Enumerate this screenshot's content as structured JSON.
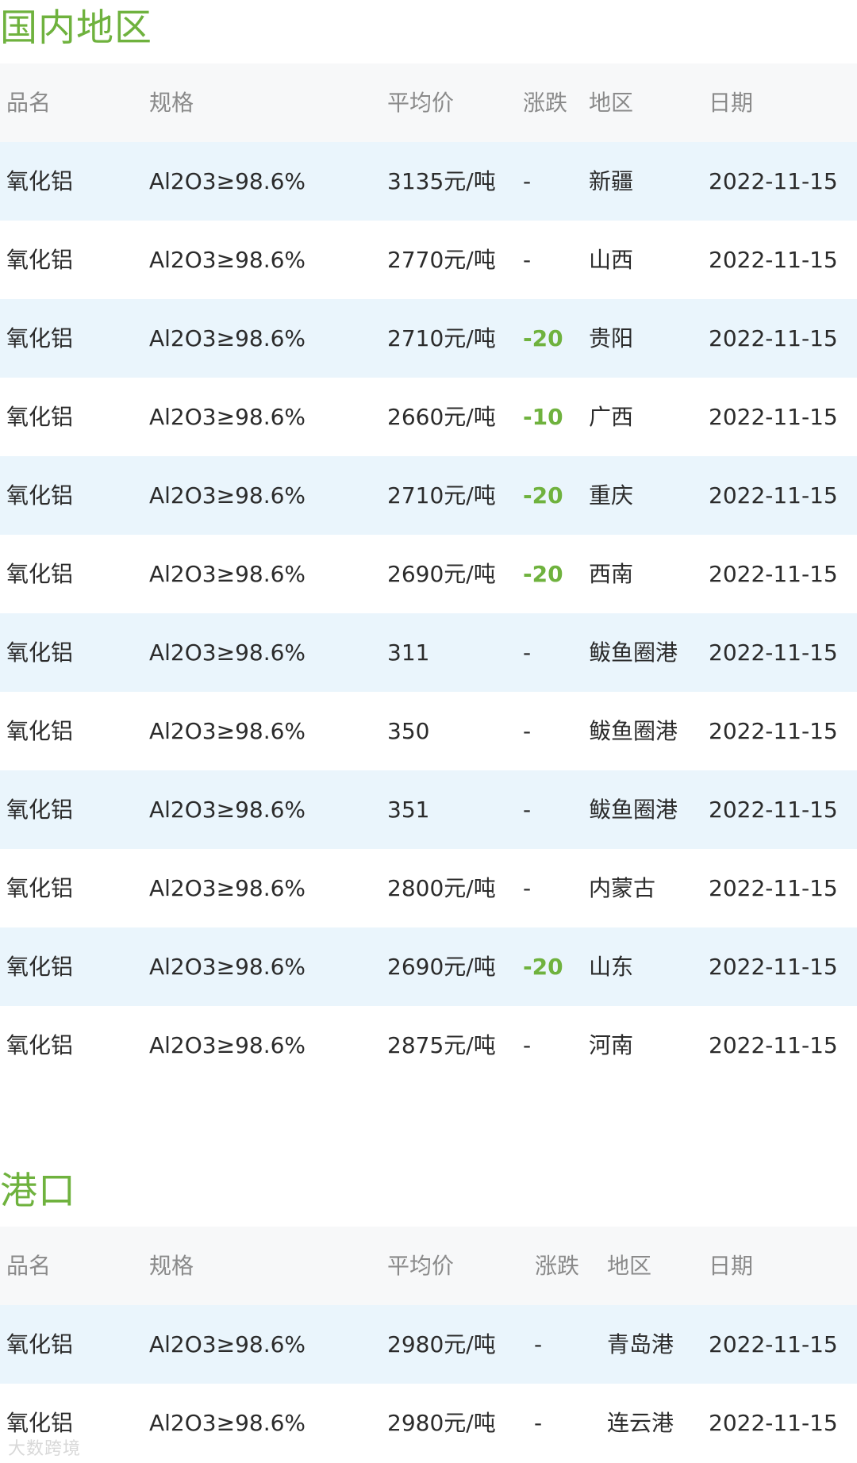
{
  "domestic": {
    "title": "国内地区",
    "headers": {
      "name": "品名",
      "spec": "规格",
      "price": "平均价",
      "change": "涨跌",
      "region": "地区",
      "date": "日期"
    },
    "rows": [
      {
        "name": "氧化铝",
        "spec": "Al2O3≥98.6%",
        "price": "3135元/吨",
        "change": "-",
        "region": "新疆",
        "date": "2022-11-15"
      },
      {
        "name": "氧化铝",
        "spec": "Al2O3≥98.6%",
        "price": "2770元/吨",
        "change": "-",
        "region": "山西",
        "date": "2022-11-15"
      },
      {
        "name": "氧化铝",
        "spec": "Al2O3≥98.6%",
        "price": "2710元/吨",
        "change": "-20",
        "region": "贵阳",
        "date": "2022-11-15"
      },
      {
        "name": "氧化铝",
        "spec": "Al2O3≥98.6%",
        "price": "2660元/吨",
        "change": "-10",
        "region": "广西",
        "date": "2022-11-15"
      },
      {
        "name": "氧化铝",
        "spec": "Al2O3≥98.6%",
        "price": "2710元/吨",
        "change": "-20",
        "region": "重庆",
        "date": "2022-11-15"
      },
      {
        "name": "氧化铝",
        "spec": "Al2O3≥98.6%",
        "price": "2690元/吨",
        "change": "-20",
        "region": "西南",
        "date": "2022-11-15"
      },
      {
        "name": "氧化铝",
        "spec": "Al2O3≥98.6%",
        "price": "311",
        "change": "-",
        "region": "鲅鱼圈港",
        "date": "2022-11-15"
      },
      {
        "name": "氧化铝",
        "spec": "Al2O3≥98.6%",
        "price": "350",
        "change": "-",
        "region": "鲅鱼圈港",
        "date": "2022-11-15"
      },
      {
        "name": "氧化铝",
        "spec": "Al2O3≥98.6%",
        "price": "351",
        "change": "-",
        "region": "鲅鱼圈港",
        "date": "2022-11-15"
      },
      {
        "name": "氧化铝",
        "spec": "Al2O3≥98.6%",
        "price": "2800元/吨",
        "change": "-",
        "region": "内蒙古",
        "date": "2022-11-15"
      },
      {
        "name": "氧化铝",
        "spec": "Al2O3≥98.6%",
        "price": "2690元/吨",
        "change": "-20",
        "region": "山东",
        "date": "2022-11-15"
      },
      {
        "name": "氧化铝",
        "spec": "Al2O3≥98.6%",
        "price": "2875元/吨",
        "change": "-",
        "region": "河南",
        "date": "2022-11-15"
      }
    ]
  },
  "port": {
    "title": "港口",
    "headers": {
      "name": "品名",
      "spec": "规格",
      "price": "平均价",
      "change": "涨跌",
      "region": "地区",
      "date": "日期"
    },
    "rows": [
      {
        "name": "氧化铝",
        "spec": "Al2O3≥98.6%",
        "price": "2980元/吨",
        "change": "-",
        "region": "青岛港",
        "date": "2022-11-15"
      },
      {
        "name": "氧化铝",
        "spec": "Al2O3≥98.6%",
        "price": "2980元/吨",
        "change": "-",
        "region": "连云港",
        "date": "2022-11-15"
      }
    ]
  },
  "watermark": "大数跨境",
  "colors": {
    "accent_green": "#6fb23e",
    "stripe_blue": "#eaf5fc",
    "header_gray": "#f7f8f9"
  }
}
